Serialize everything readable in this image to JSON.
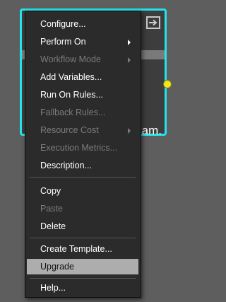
{
  "node": {
    "label_fragment": "eam.",
    "icon": "expand-box-icon",
    "border_color": "#22e4ea",
    "port_color": "#f5e521"
  },
  "menu": {
    "items": [
      {
        "label": "Configure...",
        "enabled": true
      },
      {
        "label": "Perform On",
        "enabled": true,
        "submenu": true
      },
      {
        "label": "Workflow Mode",
        "enabled": false,
        "submenu": true
      },
      {
        "label": "Add Variables...",
        "enabled": true
      },
      {
        "label": "Run On Rules...",
        "enabled": true
      },
      {
        "label": "Fallback Rules...",
        "enabled": false
      },
      {
        "label": "Resource Cost",
        "enabled": false,
        "submenu": true
      },
      {
        "label": "Execution Metrics...",
        "enabled": false
      },
      {
        "label": "Description...",
        "enabled": true
      },
      {
        "label": "Copy",
        "enabled": true
      },
      {
        "label": "Paste",
        "enabled": false
      },
      {
        "label": "Delete",
        "enabled": true
      },
      {
        "label": "Create Template...",
        "enabled": true
      },
      {
        "label": "Upgrade",
        "enabled": true,
        "highlighted": true
      },
      {
        "label": "Help...",
        "enabled": true
      }
    ],
    "highlight_color": "#adadad",
    "disabled_color": "#7c7c7c"
  }
}
